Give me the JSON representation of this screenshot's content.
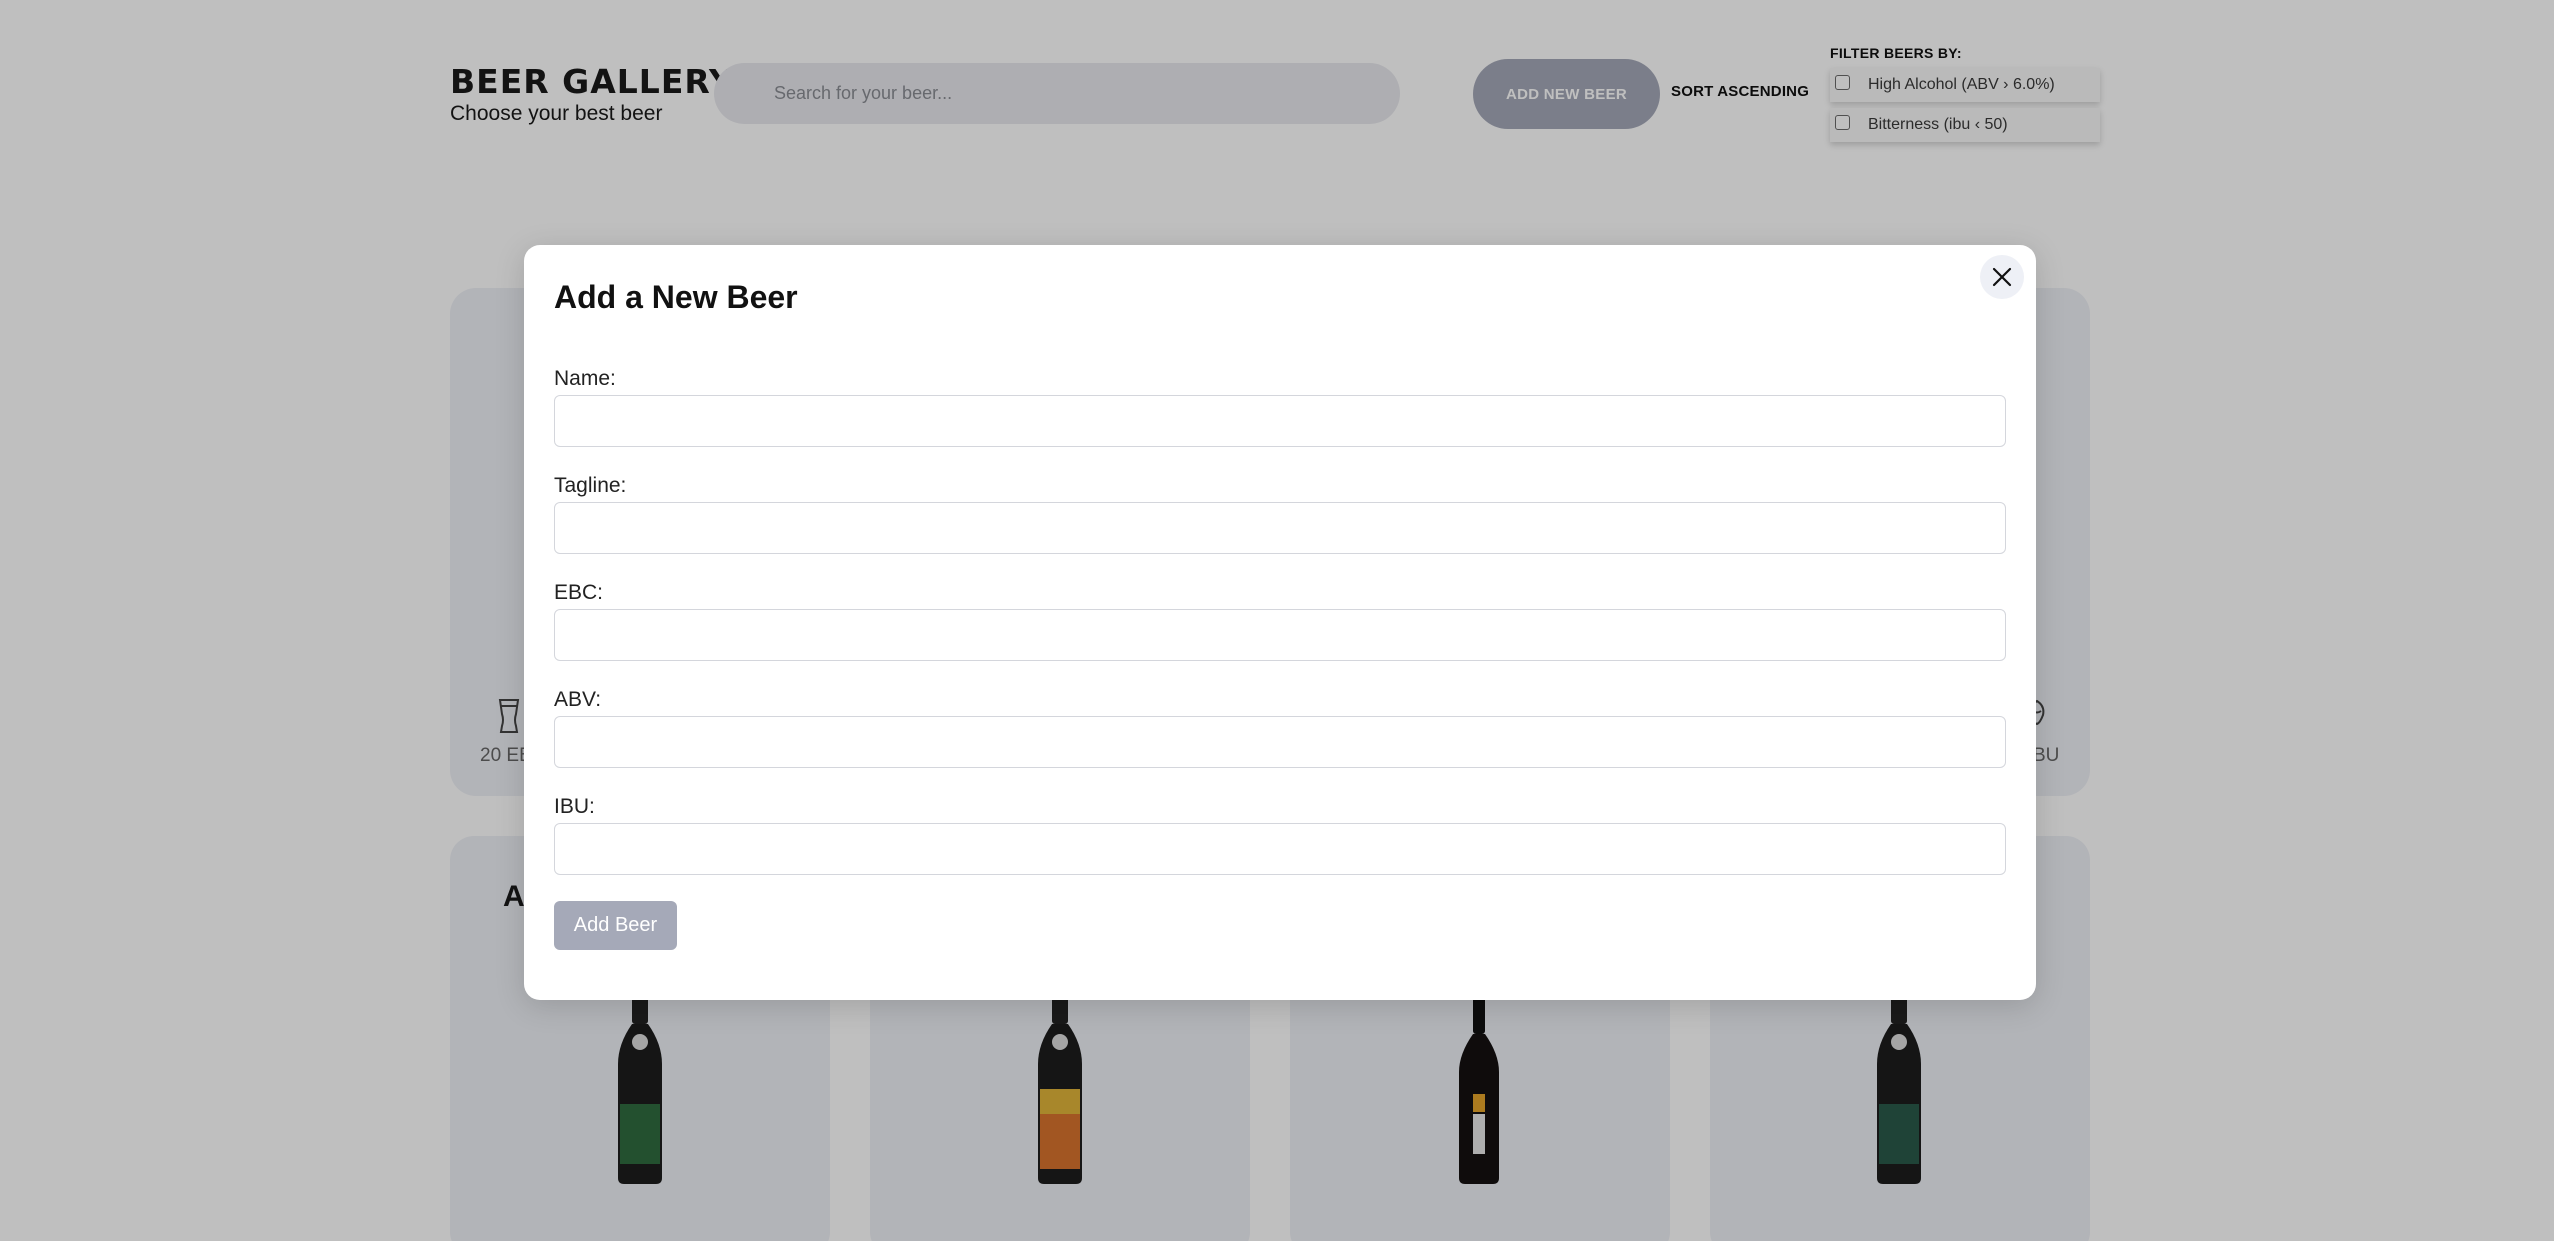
{
  "header": {
    "title": "BEER GALLERY",
    "subtitle": "Choose your best beer",
    "search_placeholder": "Search for your beer...",
    "add_new_label": "ADD NEW BEER",
    "sort_label": "SORT ASCENDING",
    "filter_title": "FILTER BEERS BY:",
    "filters": [
      {
        "label": "High Alcohol (ABV › 6.0%)",
        "checked": false
      },
      {
        "label": "Bitterness (ibu ‹ 50)",
        "checked": false
      }
    ]
  },
  "background": {
    "hero_ebc_text": "20 EB",
    "hero_ibu_text": "BU",
    "section_title": "A",
    "bottles": [
      {
        "color": "#2f6b3f",
        "label_color": "#1f7a3f",
        "icon": "beer-bottle-icon"
      },
      {
        "color": "#c23a2a",
        "label_color": "#e0a53a",
        "icon": "beer-bottle-icon"
      },
      {
        "color": "#1d1a1a",
        "label_color": "#e6a52a",
        "icon": "beer-bottle-icon"
      },
      {
        "color": "#2a5a4a",
        "label_color": "#3a6a5a",
        "icon": "beer-bottle-icon"
      }
    ]
  },
  "modal": {
    "title": "Add a New Beer",
    "fields": [
      {
        "label": "Name:",
        "value": ""
      },
      {
        "label": "Tagline:",
        "value": ""
      },
      {
        "label": "EBC:",
        "value": ""
      },
      {
        "label": "ABV:",
        "value": ""
      },
      {
        "label": "IBU:",
        "value": ""
      }
    ],
    "submit_label": "Add Beer",
    "close_icon": "close-icon"
  },
  "colors": {
    "accent_button": "#a5a9b8",
    "card_bg": "#eef0f6",
    "overlay": "rgba(0,0,0,0.25)"
  }
}
